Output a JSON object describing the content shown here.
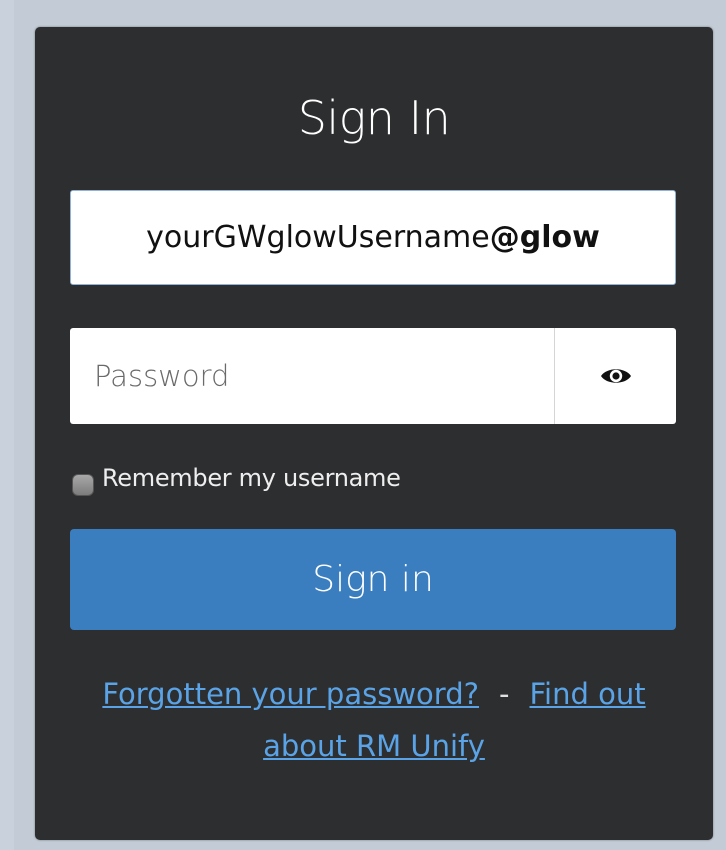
{
  "login": {
    "title": "Sign In",
    "username_prefix": "yourGWglowUsername",
    "username_suffix": "@glow",
    "password_placeholder": "Password",
    "show_password_icon": "eye-icon",
    "remember_label": "Remember my username",
    "signin_label": "Sign in",
    "forgot_link": "Forgotten your password?",
    "separator": "-",
    "about_link_line1": "Find out",
    "about_link_line2": "about RM Unify"
  },
  "colors": {
    "panel_bg": "#2d2e30",
    "accent": "#3a7ec0",
    "link": "#5aa3e6",
    "page_bg": "#c9d2dc"
  }
}
